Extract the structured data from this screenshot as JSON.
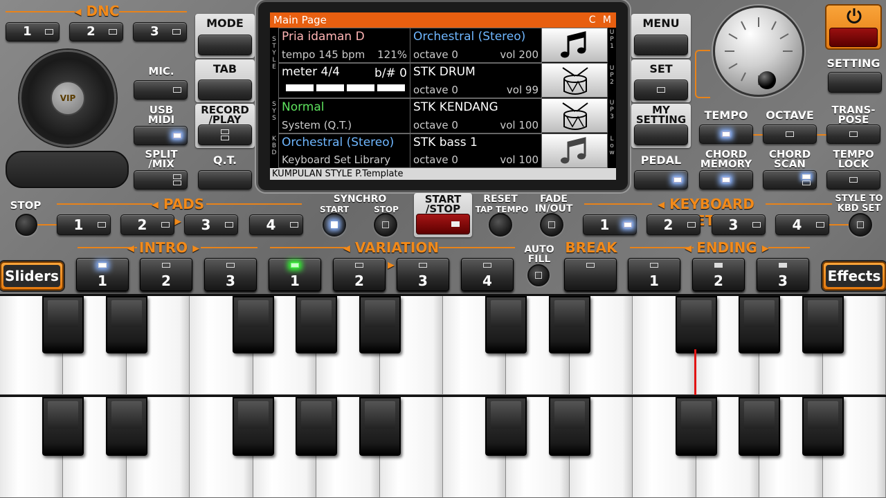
{
  "dnc": {
    "title": "DNC",
    "buttons": [
      "1",
      "2",
      "3"
    ]
  },
  "left": {
    "mic": "MIC.",
    "usb_midi": "USB\nMIDI",
    "split_mix": "SPLIT\n/MIX",
    "vip": "VIP"
  },
  "col2": {
    "mode": "MODE",
    "tab": "TAB",
    "record_play": "RECORD\n/PLAY",
    "qt": "Q.T."
  },
  "screen": {
    "header": "Main Page",
    "header_right": "C M",
    "side_style": "STYLE",
    "side_sys": "SYS",
    "side_kbd": "KBD",
    "right_up1": "UP1",
    "right_up2": "UP2",
    "right_up3": "UP3",
    "right_low": "Low",
    "style_name": "Pria idaman D",
    "tempo": "tempo 145 bpm",
    "percent": "121%",
    "meter": "meter 4/4",
    "bsharp": "b/# 0",
    "sys_name": "Normal",
    "sys_sub": "System (Q.T.)",
    "kbd_name": "Orchestral (Stereo)",
    "kbd_sub": "Keyboard Set Library",
    "up1_name": "Orchestral (Stereo)",
    "up1_oct": "octave  0",
    "up1_vol": "vol 200",
    "up2_name": "STK DRUM",
    "up2_oct": "octave  0",
    "up2_vol": "vol 99",
    "up3_name": "STK KENDANG",
    "up3_oct": "octave  0",
    "up3_vol": "vol 100",
    "low_name": "STK bass 1",
    "low_oct": "octave  0",
    "low_vol": "vol 100",
    "footer": "KUMPULAN STYLE P.Template"
  },
  "right": {
    "menu": "MENU",
    "set": "SET",
    "my_setting": "MY\nSETTING",
    "pedal": "PEDAL",
    "setting": "SETTING",
    "tempo": "TEMPO",
    "octave": "OCTAVE",
    "transpose": "TRANS-\nPOSE",
    "chord_memory": "CHORD\nMEMORY",
    "chord_scan": "CHORD\nSCAN",
    "tempo_lock": "TEMPO\nLOCK"
  },
  "row3": {
    "stop": "STOP",
    "pads": "PADS",
    "pad_buttons": [
      "1",
      "2",
      "3",
      "4"
    ],
    "synchro": "SYNCHRO",
    "synchro_start": "START",
    "synchro_stop": "STOP",
    "start_stop": "START\n/STOP",
    "reset": "RESET",
    "tap_tempo": "TAP TEMPO",
    "fade": "FADE\nIN/OUT",
    "keyboard_set": "KEYBOARD SET",
    "kbd_buttons": [
      "1",
      "2",
      "3",
      "4"
    ],
    "style_to_kbd": "STYLE TO\nKBD SET"
  },
  "row4": {
    "intro": "INTRO",
    "intro_buttons": [
      "1",
      "2",
      "3"
    ],
    "variation": "VARIATION",
    "variation_buttons": [
      "1",
      "2",
      "3",
      "4"
    ],
    "auto_fill": "AUTO\nFILL",
    "break": "BREAK",
    "ending": "ENDING",
    "ending_buttons": [
      "1",
      "2",
      "3"
    ],
    "sliders": "Sliders",
    "effects": "Effects"
  },
  "colors": {
    "accent": "#e8831a",
    "led": "#8ab4ff",
    "screen_header": "#e85f10"
  }
}
